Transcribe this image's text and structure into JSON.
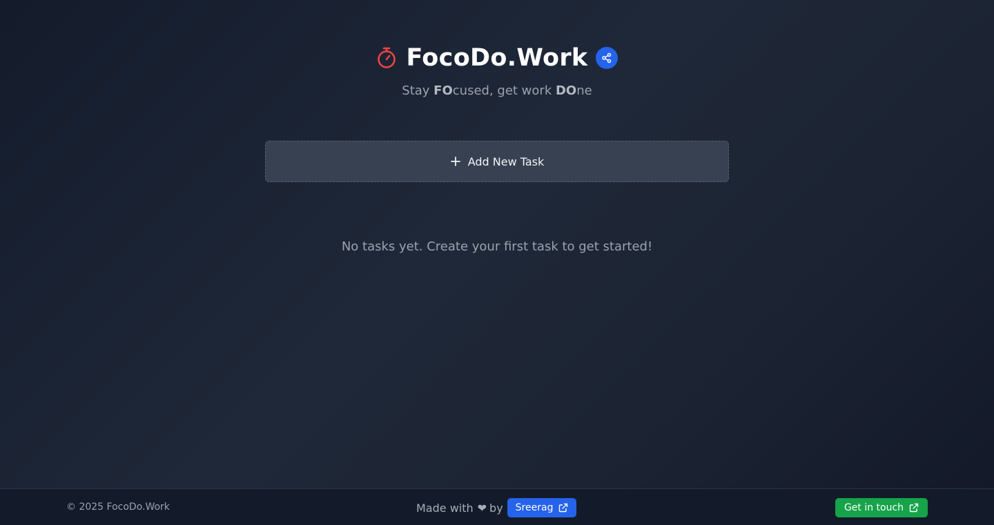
{
  "header": {
    "title": "FocoDo.Work",
    "tagline": {
      "part1": "Stay ",
      "bold1": "FO",
      "part2": "cused, get work ",
      "bold2": "DO",
      "part3": "ne"
    },
    "icons": {
      "logo": "stopwatch-icon",
      "share": "share-icon"
    },
    "colors": {
      "logo": "#ef4444",
      "share_bg": "#2563eb"
    }
  },
  "tasks": {
    "add_label": "Add New Task",
    "empty_message": "No tasks yet. Create your first task to get started!"
  },
  "footer": {
    "copyright": "© 2025 FocoDo.Work",
    "made_with": "Made with",
    "heart": "❤",
    "by": "by",
    "author": "Sreerag",
    "contact": "Get in touch",
    "colors": {
      "author_bg": "#2563eb",
      "contact_bg": "#16a34a"
    }
  }
}
